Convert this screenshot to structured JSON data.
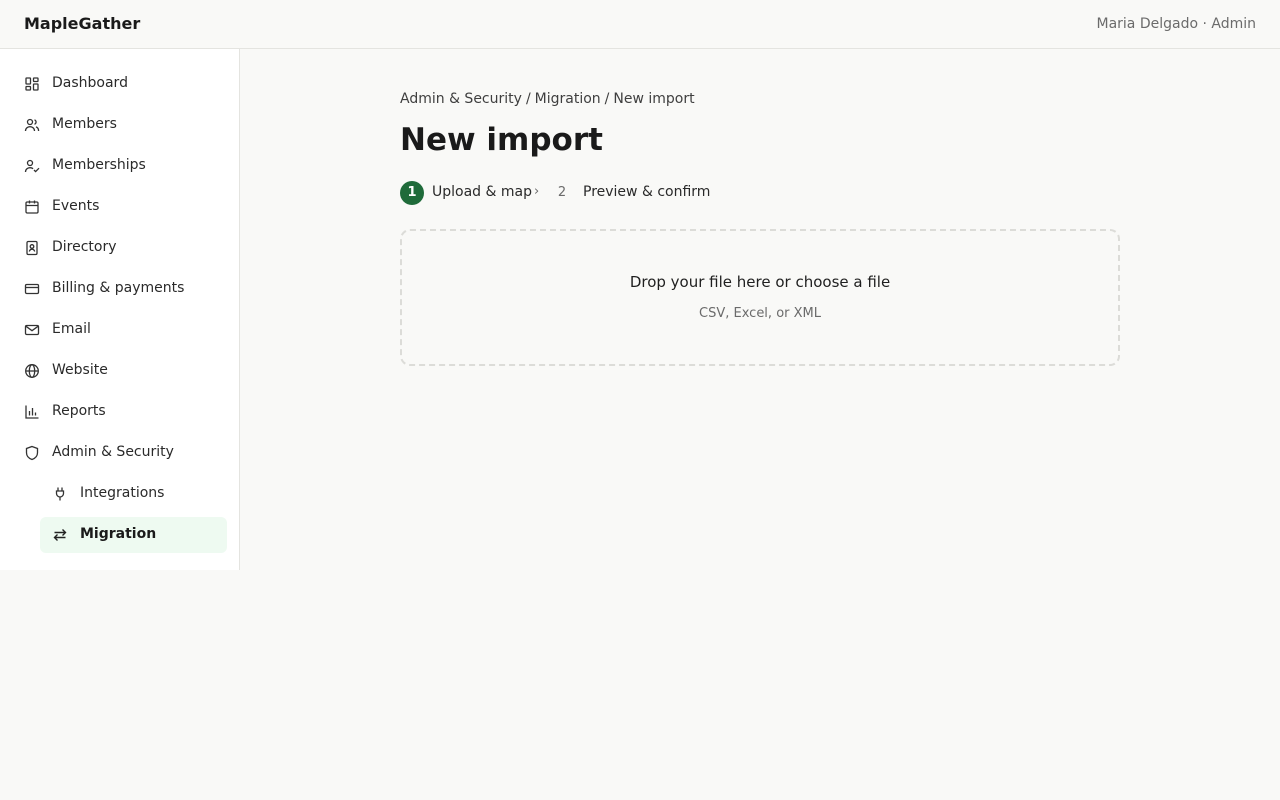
{
  "app": {
    "brand": "MapleGather",
    "user": "Maria Delgado · Admin"
  },
  "sidebar": {
    "items": [
      {
        "label": "Dashboard",
        "icon": "dashboard-icon"
      },
      {
        "label": "Members",
        "icon": "members-icon"
      },
      {
        "label": "Memberships",
        "icon": "memberships-icon"
      },
      {
        "label": "Events",
        "icon": "calendar-icon"
      },
      {
        "label": "Directory",
        "icon": "directory-icon"
      },
      {
        "label": "Billing & payments",
        "icon": "credit-card-icon"
      },
      {
        "label": "Email",
        "icon": "mail-icon"
      },
      {
        "label": "Website",
        "icon": "globe-icon"
      },
      {
        "label": "Reports",
        "icon": "bar-chart-icon"
      },
      {
        "label": "Admin & Security",
        "icon": "shield-icon"
      }
    ],
    "subitems": [
      {
        "label": "Integrations",
        "icon": "plug-icon"
      },
      {
        "label": "Migration",
        "icon": "arrows-swap-icon",
        "active": true
      }
    ]
  },
  "breadcrumb": {
    "part1": "Admin & Security",
    "part2": "Migration",
    "part3": "New import",
    "separator": "/"
  },
  "page": {
    "title": "New import"
  },
  "steps": [
    {
      "number": "1",
      "label": "Upload & map",
      "active": true
    },
    {
      "number": "2",
      "label": "Preview & confirm",
      "active": false
    }
  ],
  "steps_chevron": "›",
  "dropzone": {
    "title": "Drop your file here or choose a file",
    "subtitle": "CSV, Excel, or XML"
  },
  "colors": {
    "accent": "#1f6b3a",
    "active_bg": "#eefaf1"
  }
}
